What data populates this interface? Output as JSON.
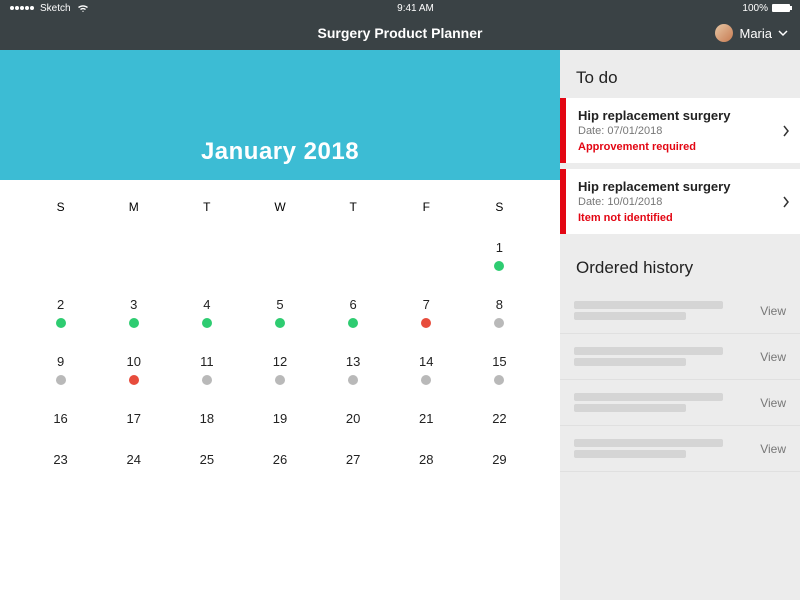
{
  "statusbar": {
    "carrier": "Sketch",
    "time": "9:41 AM",
    "battery": "100%"
  },
  "titlebar": {
    "title": "Surgery Product Planner",
    "user_name": "Maria"
  },
  "calendar": {
    "month_title": "January 2018",
    "weekdays": [
      "S",
      "M",
      "T",
      "W",
      "T",
      "F",
      "S"
    ],
    "weeks": [
      [
        null,
        null,
        null,
        null,
        null,
        null,
        {
          "n": 1,
          "dot": "green"
        }
      ],
      [
        {
          "n": 2,
          "dot": "green"
        },
        {
          "n": 3,
          "dot": "green"
        },
        {
          "n": 4,
          "dot": "green"
        },
        {
          "n": 5,
          "dot": "green"
        },
        {
          "n": 6,
          "dot": "green"
        },
        {
          "n": 7,
          "dot": "red"
        },
        {
          "n": 8,
          "dot": "grey"
        }
      ],
      [
        {
          "n": 9,
          "dot": "grey"
        },
        {
          "n": 10,
          "dot": "red"
        },
        {
          "n": 11,
          "dot": "grey"
        },
        {
          "n": 12,
          "dot": "grey"
        },
        {
          "n": 13,
          "dot": "grey"
        },
        {
          "n": 14,
          "dot": "grey"
        },
        {
          "n": 15,
          "dot": "grey"
        }
      ],
      [
        {
          "n": 16
        },
        {
          "n": 17
        },
        {
          "n": 18
        },
        {
          "n": 19
        },
        {
          "n": 20
        },
        {
          "n": 21
        },
        {
          "n": 22
        }
      ],
      [
        {
          "n": 23
        },
        {
          "n": 24
        },
        {
          "n": 25
        },
        {
          "n": 26
        },
        {
          "n": 27
        },
        {
          "n": 28
        },
        {
          "n": 29
        }
      ]
    ]
  },
  "sidebar": {
    "todo_heading": "To do",
    "todo": [
      {
        "title": "Hip replacement surgery",
        "date_label": "Date: 07/01/2018",
        "status": "Approvement required"
      },
      {
        "title": "Hip replacement surgery",
        "date_label": "Date: 10/01/2018",
        "status": "Item not identified"
      }
    ],
    "history_heading": "Ordered history",
    "history_view_label": "View",
    "history_count": 4
  }
}
